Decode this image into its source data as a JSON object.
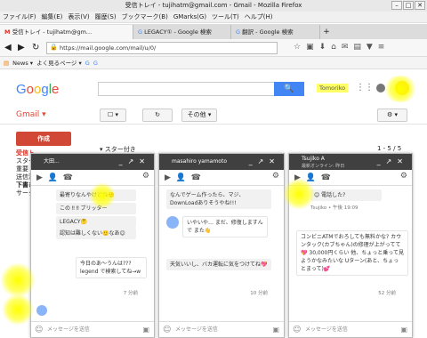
{
  "window": {
    "title": "受信トレイ - tujihatm@gmail.com - Gmail - Mozilla Firefox",
    "min": "–",
    "max": "□",
    "close": "✕"
  },
  "menu": [
    "ファイル(F)",
    "編集(E)",
    "表示(V)",
    "履歴(S)",
    "ブックマーク(B)",
    "GMarks(G)",
    "ツール(T)",
    "ヘルプ(H)"
  ],
  "tabs": [
    {
      "label": "受信トレイ - tujihatm@gm..."
    },
    {
      "label": "LEGACY① - Google 検索"
    },
    {
      "label": "翻訳 - Google 検索"
    }
  ],
  "url": "https://mail.google.com/mail/u/0/",
  "bookmarks": {
    "news": "News ▾",
    "frequent": "よく見るページ ▾"
  },
  "gmail": {
    "logo": [
      "G",
      "o",
      "o",
      "g",
      "l",
      "e"
    ],
    "logo_colors": [
      "#4285f4",
      "#ea4335",
      "#fbbc05",
      "#4285f4",
      "#34a853",
      "#ea4335"
    ],
    "search_icon": "🔍",
    "user": "Tomoriko",
    "label": "Gmail ▾",
    "select": "☐ ▾",
    "refresh": "↻",
    "more": "その他 ▾",
    "settings": "⚙ ▾",
    "compose": "作成",
    "nav": [
      "受信トレイ",
      "スター",
      "重要",
      "送信済み",
      "下書き",
      "サークル",
      "",
      "",
      "",
      "",
      "",
      ""
    ],
    "starred": "▾ スター付き",
    "pager": "1 - 5 / 5"
  },
  "chats": [
    {
      "name": "大田...",
      "messages": [
        {
          "text": "最寄りなんやけどね🙂",
          "me": false
        },
        {
          "text": "この ‼ ‼ ブリッター",
          "me": false
        },
        {
          "text": "LEGACY🤔",
          "me": false
        },
        {
          "text": "認知は難しくない🙂なあ😊",
          "me": false
        },
        {
          "text": "今日のあ〜うんは??? legend で検索してね→w",
          "me": true
        }
      ],
      "time": "7 分前",
      "input_placeholder": "メッセージを送信"
    },
    {
      "name": "masahiro yamamoto",
      "messages": [
        {
          "text": "なんでゲーム作ったら、マジ、DownLoadありそうやね!!!",
          "me": false
        },
        {
          "text": "いやいや… まだ、修復しますんで また👋",
          "me": true
        },
        {
          "text": "天気いいし、バカ運転に気をつけてね💖",
          "me": false
        }
      ],
      "time": "10 分前",
      "input_placeholder": "メッセージを送信"
    },
    {
      "name": "Tsujiko A",
      "status": "最新オンライン: 昨日",
      "messages": [
        {
          "text": "😊 電話した?",
          "me": false
        },
        {
          "text": "Tsujiko • 午後 19:09",
          "me": false
        },
        {
          "text": "コンビニATMでおろしても無料かな? カウンタック(カブちゃん)の修理が上がってて💖 30,000円くらい 他、ちょっと乗って見ようかなみたいな Uターン(あと、ちょっとまって)💕",
          "me": true
        }
      ],
      "time": "52 分前",
      "input_placeholder": "メッセージを送信"
    }
  ]
}
